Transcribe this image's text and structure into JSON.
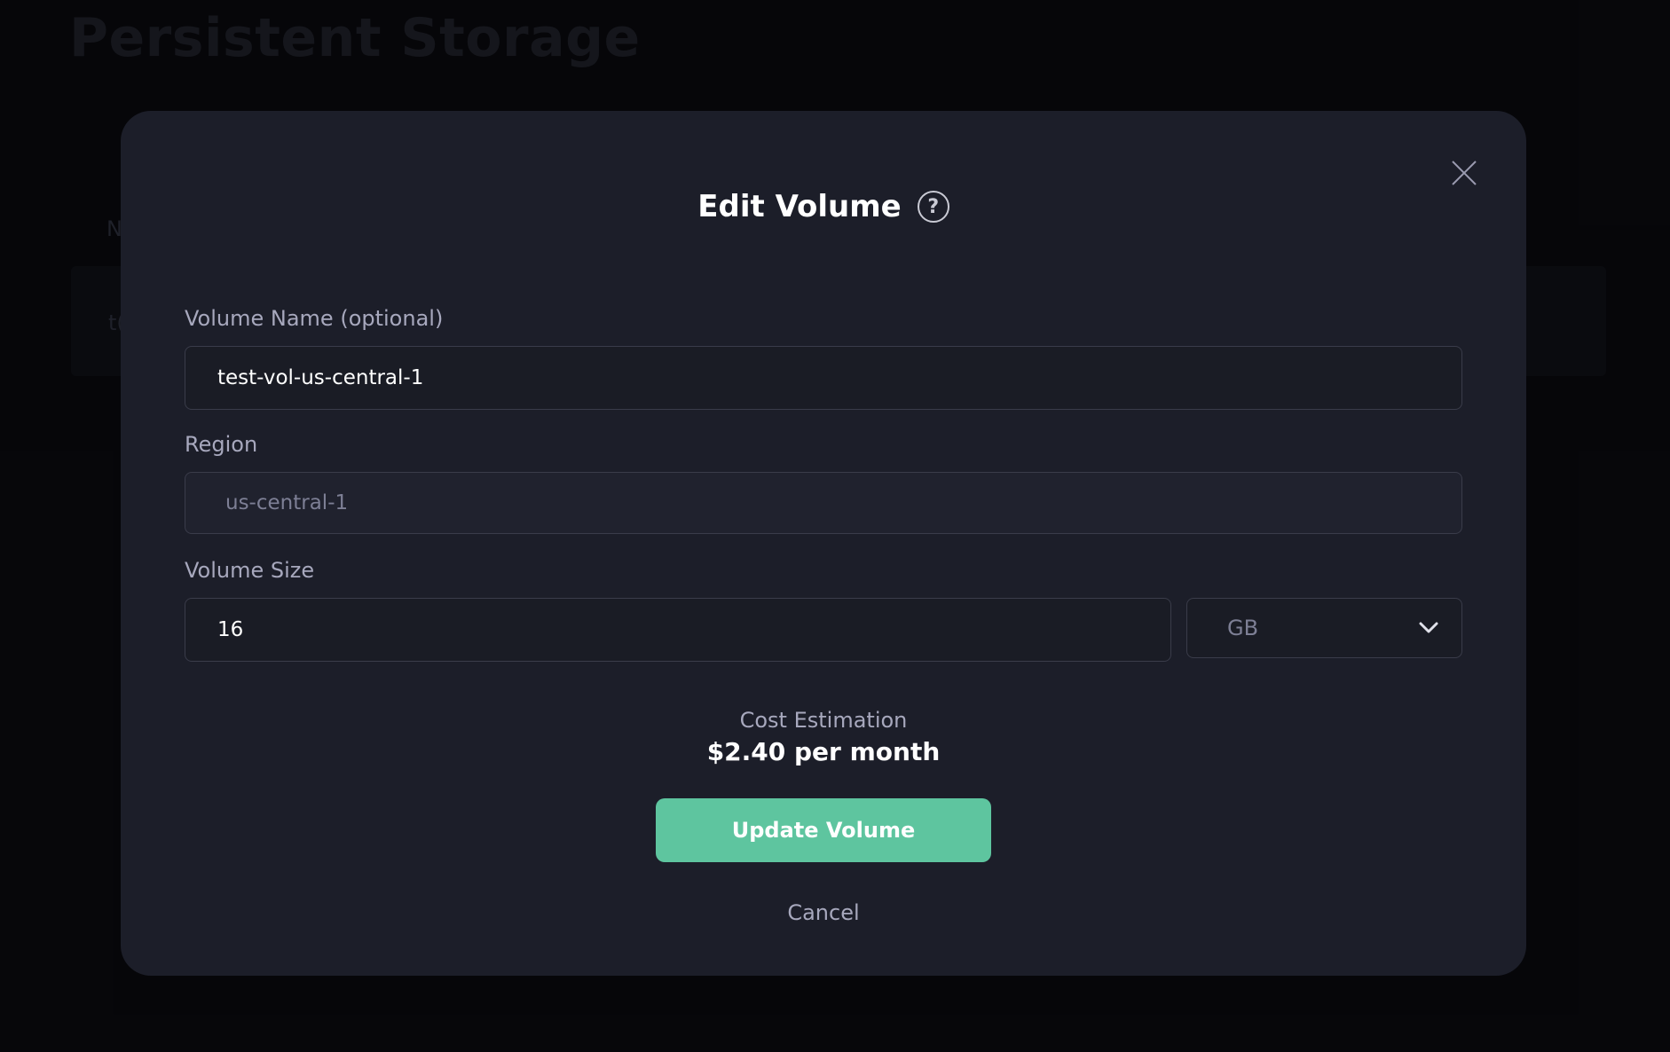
{
  "background": {
    "page_title": "Persistent Storage",
    "row_fragment_1": "N",
    "row_fragment_2": "t("
  },
  "modal": {
    "title": "Edit Volume",
    "help_icon": "question-circle-icon",
    "close_icon": "close-icon",
    "fields": {
      "name": {
        "label": "Volume Name (optional)",
        "value": "test-vol-us-central-1"
      },
      "region": {
        "label": "Region",
        "value": "us-central-1"
      },
      "size": {
        "label": "Volume Size",
        "value": "16",
        "unit": "GB"
      }
    },
    "cost": {
      "label": "Cost Estimation",
      "value": "$2.40 per month"
    },
    "update_button": "Update Volume",
    "cancel_button": "Cancel"
  },
  "colors": {
    "accent": "#5ec59f",
    "modal_bg": "#1c1e29",
    "page_bg": "#09090d"
  }
}
